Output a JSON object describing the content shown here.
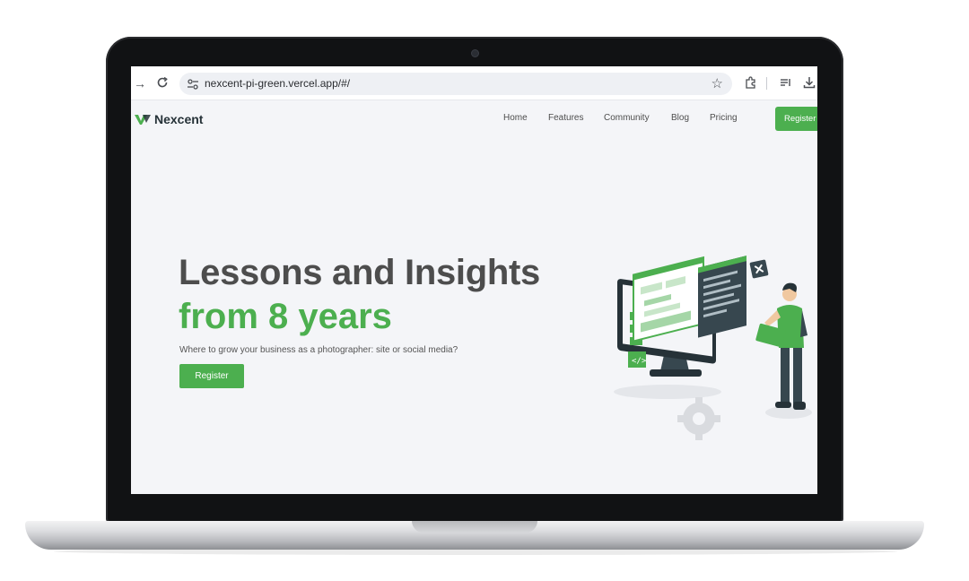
{
  "browser": {
    "url": "nexcent-pi-green.vercel.app/#/",
    "icons": [
      "forward-icon",
      "reload-icon",
      "site-settings-icon",
      "star-icon",
      "extensions-icon",
      "reading-list-icon",
      "download-icon"
    ]
  },
  "nav": {
    "brand": "Nexcent",
    "links": [
      "Home",
      "Features",
      "Community",
      "Blog",
      "Pricing"
    ],
    "register": "Register"
  },
  "hero": {
    "title_line1": "Lessons and Insights",
    "title_line2": "from 8 years",
    "subtitle": "Where to grow your business as a photographer: site or social media?",
    "button": "Register"
  },
  "colors": {
    "accent": "#4caf4f",
    "heading": "#4d4d4d",
    "background": "#f4f5f8"
  }
}
